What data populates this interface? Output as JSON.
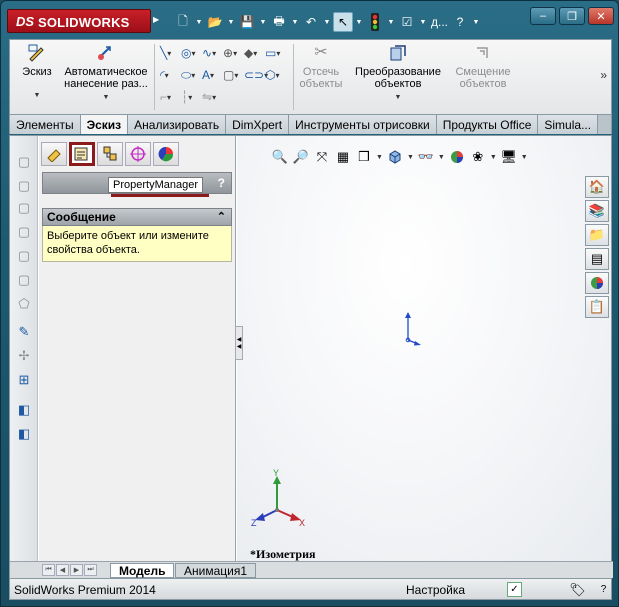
{
  "app": {
    "logo_mark": "DS",
    "logo_text": "SOLIDWORKS",
    "title_truncated": "д..."
  },
  "quick_access": [
    {
      "name": "new-document-icon",
      "glyph": "📄"
    },
    {
      "name": "open-icon",
      "glyph": "📂"
    },
    {
      "name": "save-icon",
      "glyph": "💾"
    },
    {
      "name": "print-icon",
      "glyph": "🖨"
    },
    {
      "name": "undo-icon",
      "glyph": "↶"
    },
    {
      "name": "select-pointer-icon",
      "glyph": "↖"
    },
    {
      "name": "traffic-light-icon",
      "glyph": "🚦"
    },
    {
      "name": "options-icon",
      "glyph": "☑"
    }
  ],
  "help_glyph": "?",
  "window_controls": {
    "minimize": "–",
    "restore": "❐",
    "close": "✕"
  },
  "ribbon": {
    "sketch": "Эскиз",
    "auto_dimension": "Автоматическое нанесение раз...",
    "trim": "Отсечь объекты",
    "convert": "Преобразование объектов",
    "offset": "Смещение объектов",
    "more": "»"
  },
  "ribbon_small_tools": [
    {
      "name": "line-icon",
      "glyph": "╲",
      "color": "#1d5aa3"
    },
    {
      "name": "circle-icon",
      "glyph": "◎",
      "color": "#1d5aa3"
    },
    {
      "name": "spline-icon",
      "glyph": "∿",
      "color": "#1d5aa3"
    },
    {
      "name": "dimension-small-icon",
      "glyph": "⊕",
      "color": "#555555"
    },
    {
      "name": "point-icon",
      "glyph": "◆",
      "color": "#555555"
    },
    {
      "name": "rectangle-icon",
      "glyph": "▭",
      "color": "#1d5aa3"
    },
    {
      "name": "arc-icon",
      "glyph": "◜",
      "color": "#1d5aa3"
    },
    {
      "name": "ellipse-icon",
      "glyph": "⬭",
      "color": "#1d5aa3"
    },
    {
      "name": "text-icon",
      "glyph": "A",
      "color": "#1d5aa3"
    },
    {
      "name": "plane-icon",
      "glyph": "▢",
      "color": "#555555"
    },
    {
      "name": "slot-icon",
      "glyph": "⊂⊃",
      "color": "#1d5aa3"
    },
    {
      "name": "polygon-icon",
      "glyph": "⬡",
      "color": "#1d5aa3"
    },
    {
      "name": "fillet-icon",
      "glyph": "⌐",
      "color": "#9a9a9a"
    },
    {
      "name": "chamfer-icon",
      "glyph": "┆",
      "color": "#9a9a9a"
    },
    {
      "name": "mirror-icon",
      "glyph": "⇋",
      "color": "#9a9a9a"
    }
  ],
  "tabs": [
    {
      "label": "Элементы",
      "active": false
    },
    {
      "label": "Эскиз",
      "active": true
    },
    {
      "label": "Анализировать",
      "active": false
    },
    {
      "label": "DimXpert",
      "active": false
    },
    {
      "label": "Инструменты отрисовки",
      "active": false
    },
    {
      "label": "Продукты Office",
      "active": false
    },
    {
      "label": "Simula...",
      "active": false
    }
  ],
  "panel": {
    "property_manager_header": "",
    "help": "?",
    "tooltip": "PropertyManager",
    "message_title": "Сообщение",
    "message_collapse": "⌃",
    "message_text": "Выберите объект или измените свойства объекта."
  },
  "bottom_tabs": {
    "model": "Модель",
    "animation": "Анимация1"
  },
  "viewport": {
    "view_name": "*Изометрия",
    "triad": {
      "x": "X",
      "y": "Y",
      "z": "Z"
    }
  },
  "status": {
    "product": "SolidWorks Premium 2014",
    "mode": "Настройка"
  },
  "colors": {
    "accent_red": "#8b1a1a",
    "triad_x": "#c0262d",
    "triad_y": "#2f9b3a",
    "triad_z": "#2b3db8",
    "origin_blue": "#2249c7"
  }
}
